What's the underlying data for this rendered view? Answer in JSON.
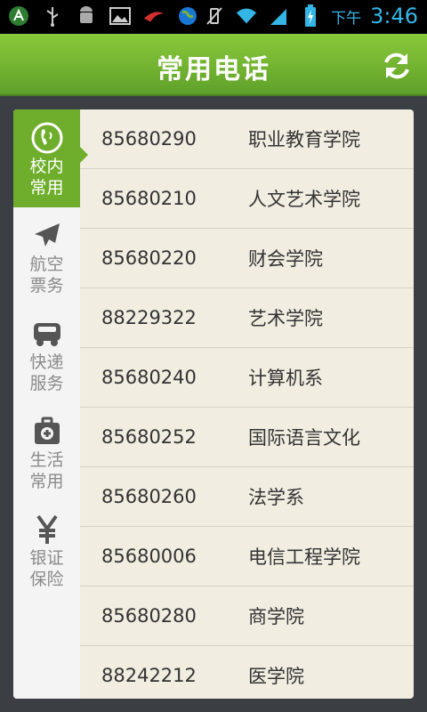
{
  "statusbar": {
    "time": "3:46",
    "ampm": "下午",
    "icons": [
      "android-app-icon",
      "usb-icon",
      "android-debug-icon",
      "image-icon",
      "notification-icon",
      "globe-icon",
      "mute-icon",
      "wifi-icon",
      "signal-icon",
      "battery-icon"
    ]
  },
  "header": {
    "title": "常用电话",
    "refresh_icon": "refresh-icon"
  },
  "sidebar": {
    "items": [
      {
        "label": "校内常用",
        "icon": "phone-icon",
        "active": true
      },
      {
        "label": "航空票务",
        "icon": "airplane-icon",
        "active": false
      },
      {
        "label": "快递服务",
        "icon": "delivery-truck-icon",
        "active": false
      },
      {
        "label": "生活常用",
        "icon": "medical-kit-icon",
        "active": false
      },
      {
        "label": "银证保险",
        "icon": "yen-icon",
        "active": false
      }
    ]
  },
  "contacts": [
    {
      "number": "85680290",
      "name": "职业教育学院"
    },
    {
      "number": "85680210",
      "name": "人文艺术学院"
    },
    {
      "number": "85680220",
      "name": "财会学院"
    },
    {
      "number": "88229322",
      "name": "艺术学院"
    },
    {
      "number": "85680240",
      "name": "计算机系"
    },
    {
      "number": "85680252",
      "name": "国际语言文化"
    },
    {
      "number": "85680260",
      "name": "法学系"
    },
    {
      "number": "85680006",
      "name": "电信工程学院"
    },
    {
      "number": "85680280",
      "name": "商学院"
    },
    {
      "number": "88242212",
      "name": "医学院"
    }
  ],
  "colors": {
    "header_green": "#6fae2c",
    "panel_bg": "#f1ede1",
    "status_blue": "#33b5e5"
  }
}
